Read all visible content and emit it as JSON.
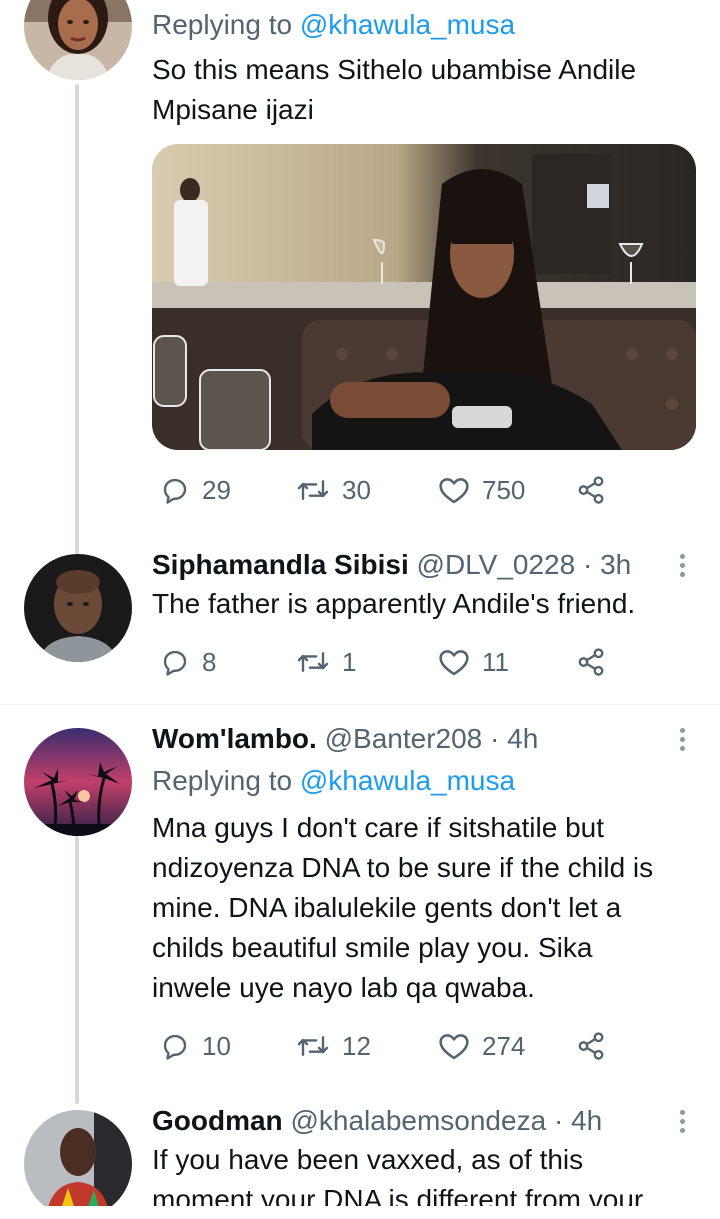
{
  "tweets": [
    {
      "reply_prefix": "Replying to",
      "reply_handle": "@khawula_musa",
      "text_lines": [
        "So this means Sithelo ubambise Andile",
        "Mpisane ijazi"
      ],
      "stats": {
        "replies": "29",
        "retweets": "30",
        "likes": "750"
      }
    },
    {
      "name": "Siphamandla Sibisi",
      "handle": "@DLV_0228",
      "time": "· 3h",
      "text": "The father is apparently Andile's friend.",
      "stats": {
        "replies": "8",
        "retweets": "1",
        "likes": "11"
      }
    },
    {
      "name": "Wom'lambo.",
      "handle": "@Banter208",
      "time": "· 4h",
      "reply_prefix": "Replying to",
      "reply_handle": "@khawula_musa",
      "text_lines": [
        "Mna guys I don't care if sitshatile but",
        "ndizoyenza DNA to be sure if the child is",
        "mine. DNA ibalulekile gents don't let a",
        "childs beautiful smile play you. Sika",
        "inwele uye nayo lab qa qwaba."
      ],
      "stats": {
        "replies": "10",
        "retweets": "12",
        "likes": "274"
      }
    },
    {
      "name": "Goodman",
      "handle": "@khalabemsondeza",
      "time": "· 4h",
      "text_lines": [
        "If you have been vaxxed, as of this",
        "moment your DNA is different from your"
      ]
    }
  ],
  "icons": {
    "reply": "reply-icon",
    "retweet": "retweet-icon",
    "like": "heart-icon",
    "share": "share-icon",
    "more": "more-icon"
  },
  "colors": {
    "link": "#1d9bf0",
    "secondary_text": "#536471",
    "thread_line": "#cfd9de"
  }
}
